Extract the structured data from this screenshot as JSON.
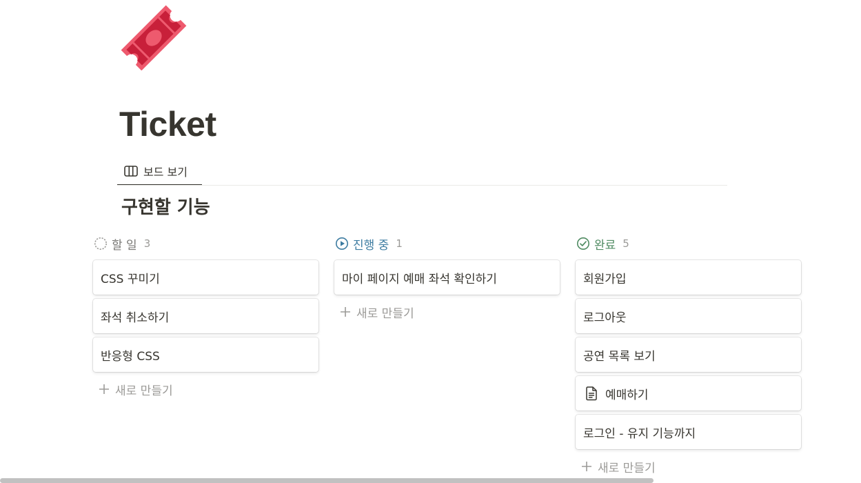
{
  "page": {
    "icon": "ticket-icon",
    "title": "Ticket"
  },
  "view_tab": {
    "icon": "board-view-icon",
    "label": "보드 보기"
  },
  "board": {
    "title": "구현할 기능",
    "new_item_label": "새로 만들기",
    "columns": [
      {
        "status": "할 일",
        "count": "3",
        "icon": "todo-circle-icon",
        "color": "#9b9a97",
        "cards": [
          "CSS 꾸미기",
          "좌석 취소하기",
          "반응형 CSS"
        ]
      },
      {
        "status": "진행 중",
        "count": "1",
        "icon": "in-progress-icon",
        "color": "#3d7ca1",
        "cards": [
          "마이 페이지 예매 좌석 확인하기"
        ]
      },
      {
        "status": "완료",
        "count": "5",
        "icon": "done-check-icon",
        "color": "#4f8b62",
        "cards": [
          "회원가입",
          "로그아웃",
          "공연 목록 보기",
          "예매하기",
          "로그인 - 유지 기능까지"
        ],
        "doc_icon_card_index": 3
      }
    ]
  },
  "colors": {
    "text": "#37352f",
    "muted": "#9b9a97",
    "ticket_red": "#e0394e"
  }
}
